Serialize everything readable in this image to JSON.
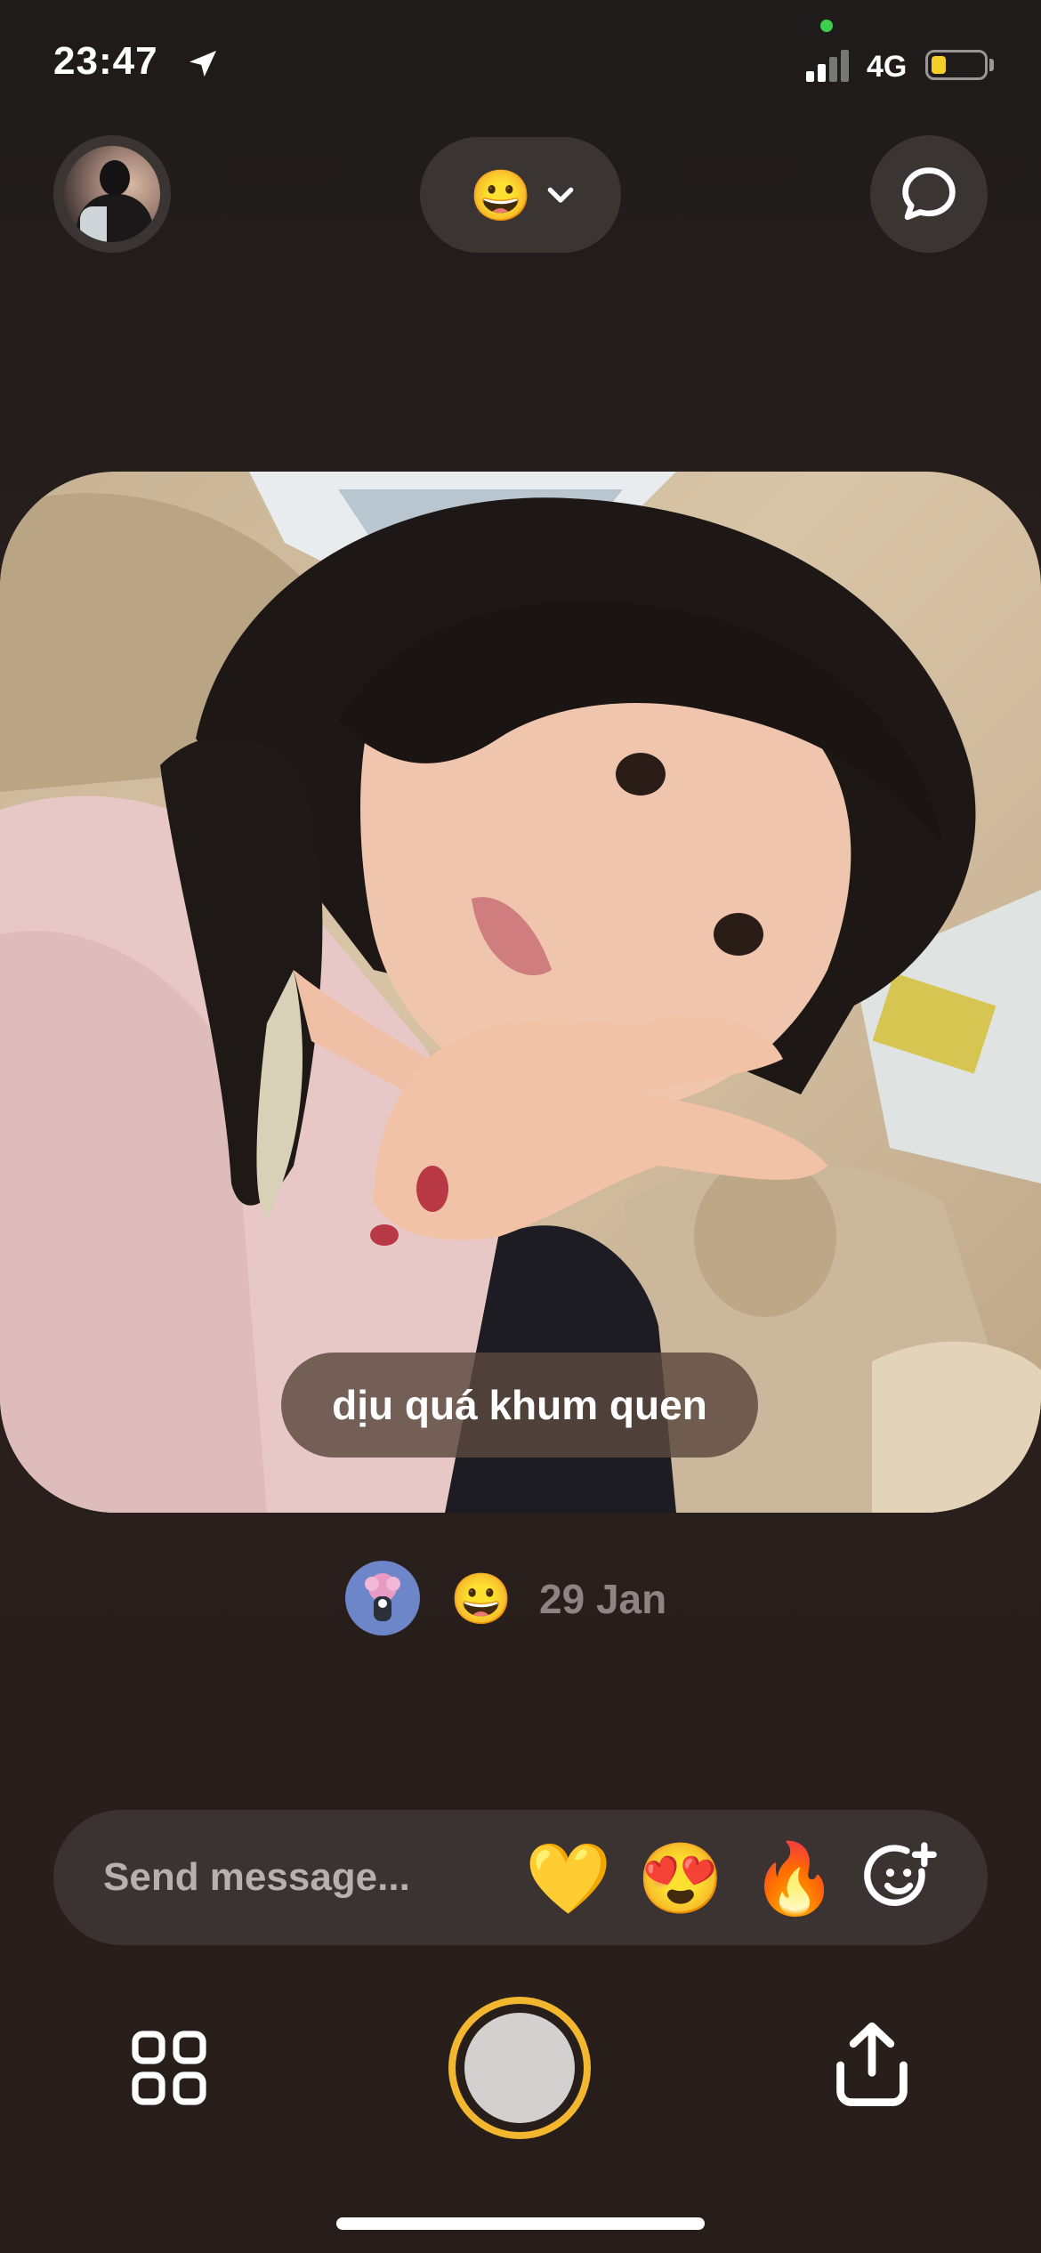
{
  "status_bar": {
    "time": "23:47",
    "network": "4G",
    "icons": [
      "location-arrow-icon",
      "signal-icon",
      "battery-icon"
    ],
    "battery_color": "#f4cf2a",
    "signal_bars_active": 2
  },
  "top_nav": {
    "filter_emoji": "😀",
    "icons": [
      "profile-avatar",
      "chevron-down-icon",
      "chat-bubble-icon"
    ]
  },
  "post": {
    "caption": "dịu quá khum quen",
    "reaction_emoji": "😀",
    "date": "29 Jan"
  },
  "message_bar": {
    "placeholder": "Send message...",
    "reactions": [
      "💛",
      "😍",
      "🔥"
    ],
    "add_reaction_icon": "emoji-plus-icon"
  },
  "bottom_bar": {
    "icons": [
      "grid-icon",
      "shutter-button",
      "share-upload-icon"
    ],
    "shutter_ring_color": "#f3b72f"
  }
}
